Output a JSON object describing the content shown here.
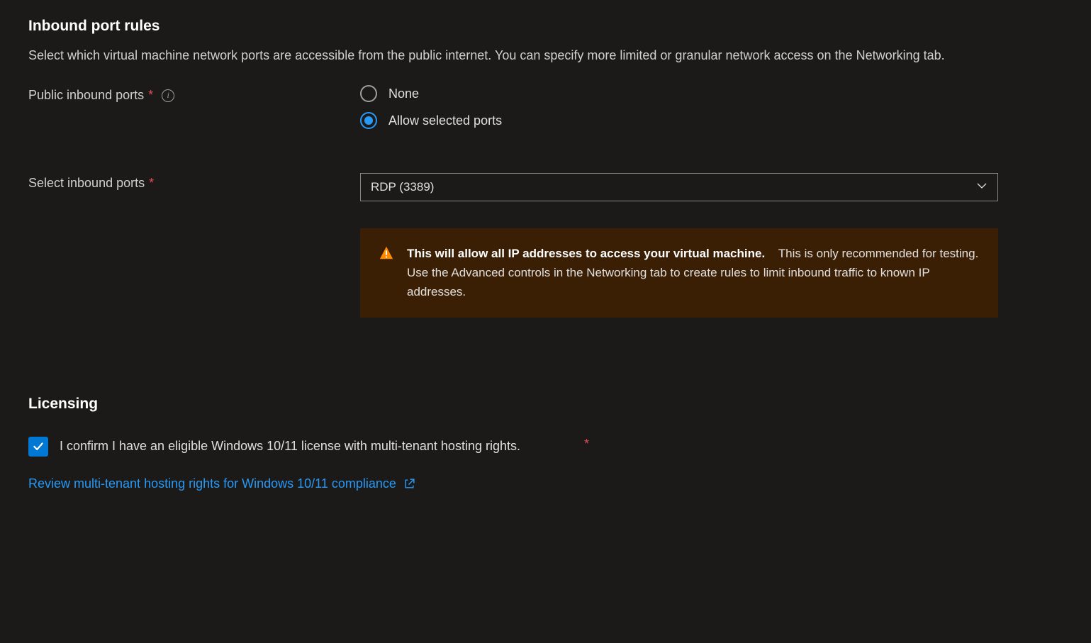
{
  "inbound": {
    "heading": "Inbound port rules",
    "description": "Select which virtual machine network ports are accessible from the public internet. You can specify more limited or granular network access on the Networking tab.",
    "public_ports_label": "Public inbound ports",
    "option_none": "None",
    "option_allow": "Allow selected ports",
    "select_ports_label": "Select inbound ports",
    "select_ports_value": "RDP (3389)",
    "warning_bold": "This will allow all IP addresses to access your virtual machine.",
    "warning_rest": "This is only recommended for testing.  Use the Advanced controls in the Networking tab to create rules to limit inbound traffic to known IP addresses."
  },
  "licensing": {
    "heading": "Licensing",
    "checkbox_label": "I confirm I have an eligible Windows 10/11 license with multi-tenant hosting rights.",
    "compliance_link": "Review multi-tenant hosting rights for Windows 10/11 compliance"
  }
}
